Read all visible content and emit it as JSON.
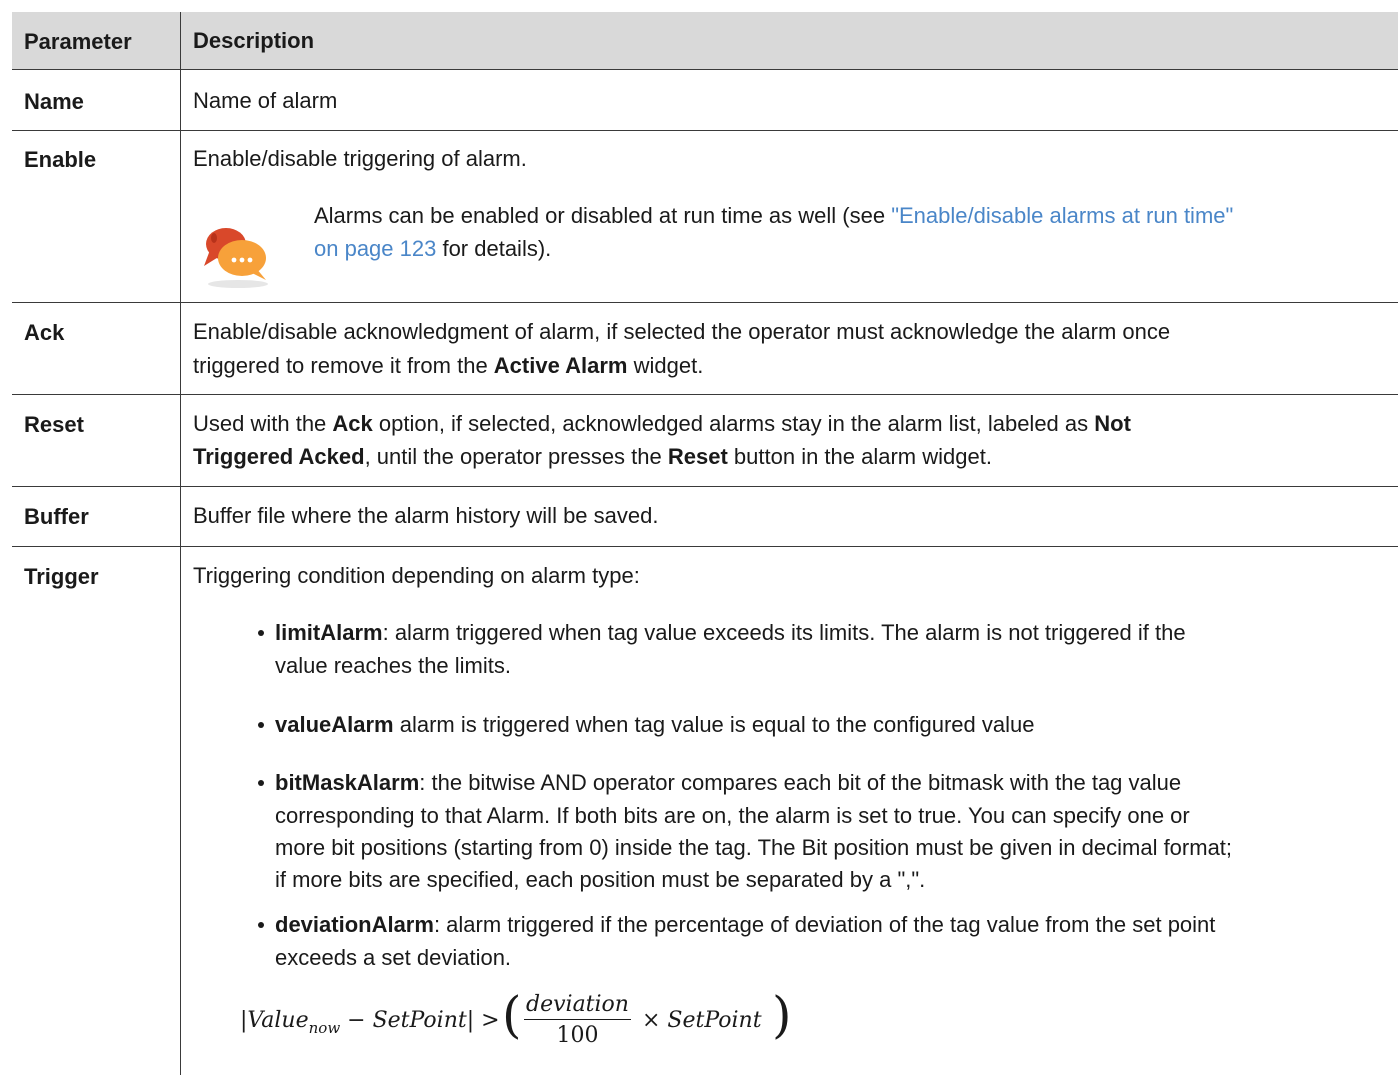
{
  "header": {
    "col_param": "Parameter",
    "col_desc": "Description"
  },
  "rows": {
    "name": {
      "param": "Name",
      "desc": "Name of alarm"
    },
    "enable": {
      "param": "Enable",
      "desc": "Enable/disable triggering of alarm.",
      "note_a": "Alarms can be enabled or disabled at run time as well (see ",
      "note_link_a": "\"Enable/disable alarms at run time\"",
      "note_link_b": "on page 123",
      "note_b": " for details)."
    },
    "ack": {
      "param": "Ack",
      "line1": "Enable/disable acknowledgment of alarm, if selected the operator must acknowledge the alarm once",
      "line2_a": "triggered to remove it from the ",
      "line2_bold": "Active Alarm",
      "line2_b": " widget."
    },
    "reset": {
      "param": "Reset",
      "a": "Used with the ",
      "b_bold": "Ack",
      "c": " option, if selected, acknowledged alarms stay in the alarm list, labeled as ",
      "d_bold": "Not",
      "e_bold": "Triggered Acked",
      "f": ", until the operator presses the ",
      "g_bold": "Reset",
      "h": " button in the alarm widget."
    },
    "buffer": {
      "param": "Buffer",
      "desc": "Buffer file where the alarm history will be saved."
    },
    "trigger": {
      "param": "Trigger",
      "desc": "Triggering condition depending on alarm type:",
      "limit": {
        "name": "limitAlarm",
        "l1": ": alarm triggered when tag value exceeds its limits. The alarm is not triggered if the",
        "l2": "value reaches the limits."
      },
      "value": {
        "name": "valueAlarm",
        "l1": " alarm is triggered when tag value is equal to the configured value"
      },
      "bitmask": {
        "name": "bitMaskAlarm",
        "l1": ": the bitwise AND operator compares each bit of the bitmask with the tag value",
        "l2": "corresponding to that Alarm. If both bits are on, the alarm is set to true. You can specify one or",
        "l3": "more bit positions (starting from 0) inside the tag. The Bit position must be given in decimal format;",
        "l4": "if more bits are specified, each position must be separated by a \",\"."
      },
      "deviation": {
        "name": "deviationAlarm",
        "l1": ": alarm triggered if the percentage of deviation of the tag value from the set point",
        "l2": "exceeds a set deviation."
      },
      "formula": {
        "left_a": "|Value",
        "left_sub": "now",
        "left_b": " − SetPoint| >",
        "open": "(",
        "num": "deviation",
        "den": "100",
        "times": "× SetPoint",
        "close": ")"
      }
    }
  },
  "colors": {
    "header_bg": "#d9d9d9",
    "link": "#4a86c8",
    "rule": "#3a3a3a"
  },
  "icons": {
    "note": "chat-bubbles-icon",
    "bullet": "bullet-dot-icon"
  }
}
